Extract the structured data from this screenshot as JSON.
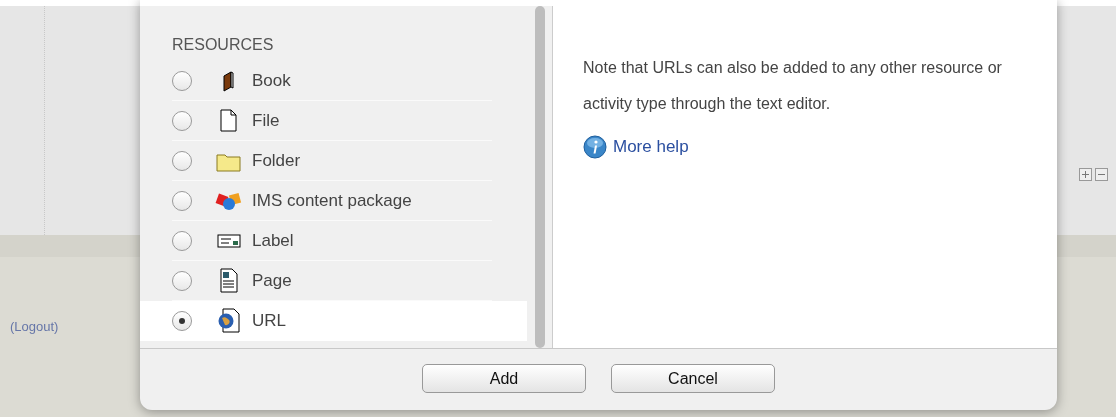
{
  "page": {
    "logout_link": "(Logout)"
  },
  "dialog": {
    "section_heading": "RESOURCES",
    "resources": [
      {
        "label": "Book",
        "selected": false
      },
      {
        "label": "File",
        "selected": false
      },
      {
        "label": "Folder",
        "selected": false
      },
      {
        "label": "IMS content package",
        "selected": false
      },
      {
        "label": "Label",
        "selected": false
      },
      {
        "label": "Page",
        "selected": false
      },
      {
        "label": "URL",
        "selected": true
      }
    ],
    "help_text": "Note that URLs can also be added to any other resource or activity type through the text editor.",
    "more_help_link": "More help",
    "buttons": [
      "Add",
      "Cancel"
    ]
  }
}
